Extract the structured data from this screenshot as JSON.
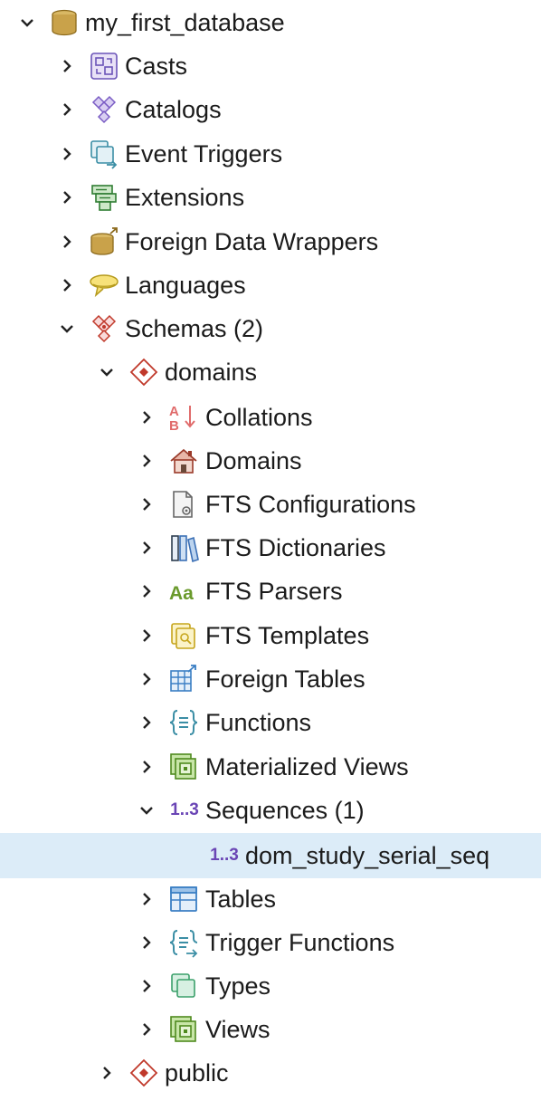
{
  "tree": {
    "database": {
      "label": "my_first_database",
      "expanded": true
    },
    "db_children": [
      {
        "label": "Casts",
        "icon": "casts-icon"
      },
      {
        "label": "Catalogs",
        "icon": "catalogs-icon"
      },
      {
        "label": "Event Triggers",
        "icon": "event-triggers-icon"
      },
      {
        "label": "Extensions",
        "icon": "extensions-icon"
      },
      {
        "label": "Foreign Data Wrappers",
        "icon": "foreign-data-wrappers-icon"
      },
      {
        "label": "Languages",
        "icon": "languages-icon"
      },
      {
        "label": "Schemas (2)",
        "icon": "schemas-icon",
        "expanded": true
      }
    ],
    "schema_domains": {
      "label": "domains",
      "icon": "schema-icon",
      "expanded": true
    },
    "domain_children": [
      {
        "label": "Collations",
        "icon": "collations-icon"
      },
      {
        "label": "Domains",
        "icon": "domains-icon"
      },
      {
        "label": "FTS Configurations",
        "icon": "fts-configurations-icon"
      },
      {
        "label": "FTS Dictionaries",
        "icon": "fts-dictionaries-icon"
      },
      {
        "label": "FTS Parsers",
        "icon": "fts-parsers-icon",
        "icon_text": "Aa"
      },
      {
        "label": "FTS Templates",
        "icon": "fts-templates-icon"
      },
      {
        "label": "Foreign Tables",
        "icon": "foreign-tables-icon"
      },
      {
        "label": "Functions",
        "icon": "functions-icon"
      },
      {
        "label": "Materialized Views",
        "icon": "materialized-views-icon"
      },
      {
        "label": "Sequences (1)",
        "icon": "sequences-icon",
        "icon_text": "1..3",
        "expanded": true
      },
      {
        "label": "dom_study_serial_seq",
        "icon": "sequence-icon",
        "icon_text": "1..3",
        "selected": true
      },
      {
        "label": "Tables",
        "icon": "tables-icon"
      },
      {
        "label": "Trigger Functions",
        "icon": "trigger-functions-icon"
      },
      {
        "label": "Types",
        "icon": "types-icon"
      },
      {
        "label": "Views",
        "icon": "views-icon"
      }
    ],
    "schema_public": {
      "label": "public",
      "icon": "schema-icon",
      "expanded": false
    }
  },
  "colors": {
    "selection": "#dcecf8",
    "text": "#1b1b1b",
    "chevron": "#222222"
  }
}
